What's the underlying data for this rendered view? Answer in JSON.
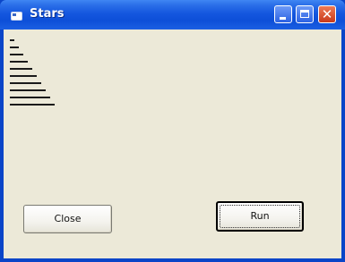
{
  "window": {
    "title": "Stars"
  },
  "output": {
    "rows": [
      {
        "text": "*",
        "count": 1
      },
      {
        "text": "**",
        "count": 2
      },
      {
        "text": "***",
        "count": 3
      },
      {
        "text": "****",
        "count": 4
      },
      {
        "text": "*****",
        "count": 5
      },
      {
        "text": "******",
        "count": 6
      },
      {
        "text": "*******",
        "count": 7
      },
      {
        "text": "********",
        "count": 8
      },
      {
        "text": "*********",
        "count": 9
      },
      {
        "text": "**********",
        "count": 10
      }
    ]
  },
  "buttons": {
    "close_label": "Close",
    "run_label": "Run"
  },
  "colors": {
    "title_bar": "#0d4fd8",
    "client_background": "#ece9d8",
    "close_button_red": "#c8391a"
  },
  "icons": {
    "app": "window-icon",
    "minimize": "minimize-icon",
    "maximize": "maximize-icon",
    "close": "close-icon"
  }
}
